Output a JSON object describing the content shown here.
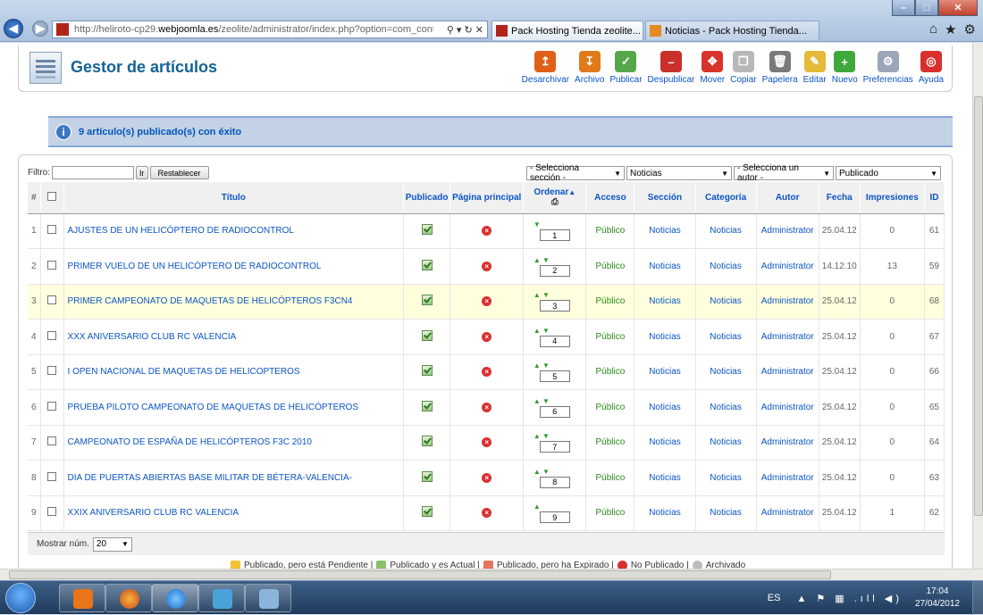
{
  "browser": {
    "url_prefix": "http://heliroto-cp29.",
    "url_domain": "webjoomla.es",
    "url_path": "/zeolite/administrator/index.php?option=com_conten",
    "tools": "⚲ ▾ ↻ ✕",
    "tabs": [
      {
        "label": "Pack Hosting Tienda zeolite...",
        "close": "✕"
      },
      {
        "label": "Noticias - Pack Hosting Tienda...",
        "close": ""
      }
    ],
    "back_label": "◀",
    "fwd_label": "▶"
  },
  "header": {
    "title": "Gestor de artículos",
    "toolbar": [
      {
        "label": "Desarchivar",
        "icon": "unarchive-icon",
        "color": "#e0601a",
        "glyph": "↥"
      },
      {
        "label": "Archivo",
        "icon": "archive-icon",
        "color": "#e07a1a",
        "glyph": "↧"
      },
      {
        "label": "Publicar",
        "icon": "publish-icon",
        "color": "#55a84a",
        "glyph": "✓"
      },
      {
        "label": "Despublicar",
        "icon": "unpublish-icon",
        "color": "#c9302c",
        "glyph": "–"
      },
      {
        "label": "Mover",
        "icon": "move-icon",
        "color": "#d8342b",
        "glyph": "✥"
      },
      {
        "label": "Copiar",
        "icon": "copy-icon",
        "color": "#b8b8b8",
        "glyph": "❐"
      },
      {
        "label": "Papelera",
        "icon": "trash-icon",
        "color": "#7a7a7a",
        "glyph": "🗑"
      },
      {
        "label": "Editar",
        "icon": "edit-icon",
        "color": "#e5b93a",
        "glyph": "✎"
      },
      {
        "label": "Nuevo",
        "icon": "new-icon",
        "color": "#3fa83a",
        "glyph": "+"
      },
      {
        "label": "Preferencias",
        "icon": "preferences-icon",
        "color": "#9aa7b8",
        "glyph": "⚙"
      },
      {
        "label": "Ayuda",
        "icon": "help-icon",
        "color": "#d9302f",
        "glyph": "◎"
      }
    ]
  },
  "message": {
    "text": "9 artículo(s) publicado(s) con éxito"
  },
  "filter": {
    "label": "Filtro:",
    "value": "",
    "go_label": "Ir",
    "reset_label": "Restablecer",
    "section_select": "- Selecciona sección -",
    "category_select": "Noticias",
    "author_select": "- Selecciona un autor -",
    "state_select": "Publicado"
  },
  "columns": {
    "num": "#",
    "title": "Título",
    "published": "Publicado",
    "frontpage": "Página principal",
    "order": "Ordenar",
    "access": "Acceso",
    "section": "Sección",
    "category": "Categoría",
    "author": "Autor",
    "date": "Fecha",
    "hits": "Impresiones",
    "id": "ID"
  },
  "rows": [
    {
      "num": "1",
      "title": "AJUSTES DE UN HELICÓPTERO DE RADIOCONTROL",
      "arrows": "  ▼",
      "order": "1",
      "access": "Público",
      "section": "Noticias",
      "category": "Noticias",
      "author": "Administrator",
      "date": "25.04.12",
      "hits": "0",
      "id": "61"
    },
    {
      "num": "2",
      "title": "PRIMER VUELO DE UN HELICÓPTERO DE RADIOCONTROL",
      "arrows": "▲ ▼",
      "order": "2",
      "access": "Público",
      "section": "Noticias",
      "category": "Noticias",
      "author": "Administrator",
      "date": "14.12.10",
      "hits": "13",
      "id": "59"
    },
    {
      "num": "3",
      "title": "PRIMER CAMPEONATO DE MAQUETAS DE HELICÓPTEROS F3CN4",
      "arrows": "▲ ▼",
      "order": "3",
      "access": "Público",
      "section": "Noticias",
      "category": "Noticias",
      "author": "Administrator",
      "date": "25.04.12",
      "hits": "0",
      "id": "68"
    },
    {
      "num": "4",
      "title": "XXX ANIVERSARIO CLUB RC VALENCIA",
      "arrows": "▲ ▼",
      "order": "4",
      "access": "Público",
      "section": "Noticias",
      "category": "Noticias",
      "author": "Administrator",
      "date": "25.04.12",
      "hits": "0",
      "id": "67"
    },
    {
      "num": "5",
      "title": "I OPEN NACIONAL DE MAQUETAS DE HELICOPTEROS",
      "arrows": "▲ ▼",
      "order": "5",
      "access": "Público",
      "section": "Noticias",
      "category": "Noticias",
      "author": "Administrator",
      "date": "25.04.12",
      "hits": "0",
      "id": "66"
    },
    {
      "num": "6",
      "title": "PRUEBA PILOTO CAMPEONATO DE MAQUETAS DE HELICÓPTEROS",
      "arrows": "▲ ▼",
      "order": "6",
      "access": "Público",
      "section": "Noticias",
      "category": "Noticias",
      "author": "Administrator",
      "date": "25.04.12",
      "hits": "0",
      "id": "65"
    },
    {
      "num": "7",
      "title": "CAMPEONATO DE ESPAÑA DE HELICÓPTEROS F3C 2010",
      "arrows": "▲ ▼",
      "order": "7",
      "access": "Público",
      "section": "Noticias",
      "category": "Noticias",
      "author": "Administrator",
      "date": "25.04.12",
      "hits": "0",
      "id": "64"
    },
    {
      "num": "8",
      "title": "DIA DE PUERTAS ABIERTAS BASE MILITAR DE BÉTERA-VALENCIA-",
      "arrows": "▲ ▼",
      "order": "8",
      "access": "Público",
      "section": "Noticias",
      "category": "Noticias",
      "author": "Administrator",
      "date": "25.04.12",
      "hits": "0",
      "id": "63"
    },
    {
      "num": "9",
      "title": "XXIX ANIVERSARIO CLUB RC VALENCIA",
      "arrows": "▲",
      "order": "9",
      "access": "Público",
      "section": "Noticias",
      "category": "Noticias",
      "author": "Administrator",
      "date": "25.04.12",
      "hits": "1",
      "id": "62"
    }
  ],
  "footer": {
    "show_label": "Mostrar núm.",
    "show_value": "20"
  },
  "legend": {
    "pending": "Publicado, pero está Pendiente |",
    "current": "Publicado y es Actual |",
    "expired": "Publicado, pero ha Expirado |",
    "unpublished": "No Publicado |",
    "archived": "Archivado"
  },
  "taskbar": {
    "lang": "ES",
    "time": "17:04",
    "date": "27/04/2012",
    "tray_icons": "▲ ⚑ ▦ .ıll ◀)"
  },
  "colors": {
    "link": "#0b55c4",
    "access_green": "#2a8a1b",
    "highlight_row": "#ffffdd"
  }
}
